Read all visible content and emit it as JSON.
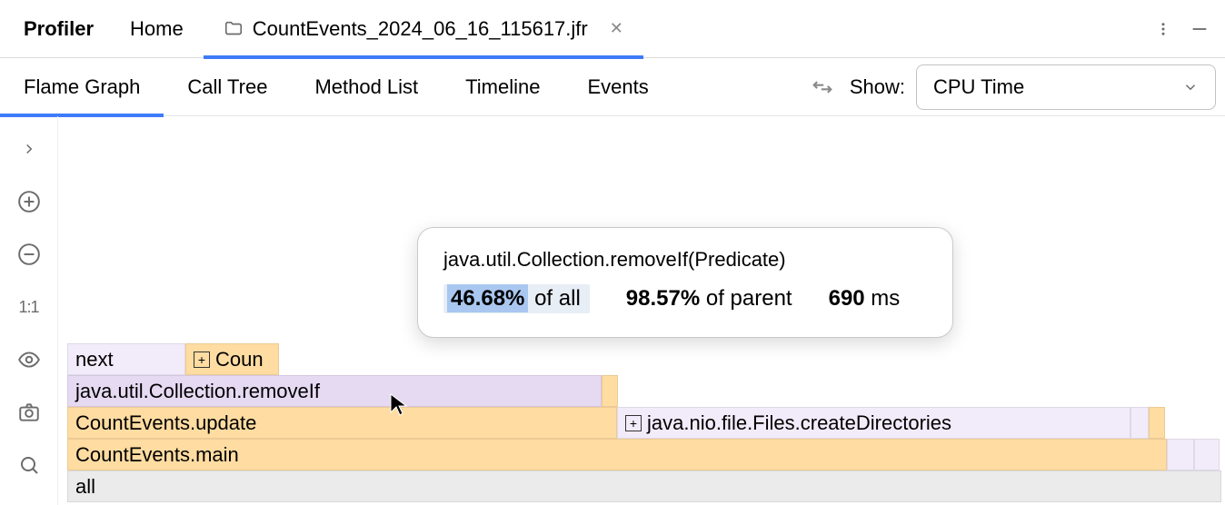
{
  "header": {
    "title": "Profiler",
    "tabs": [
      {
        "label": "Home",
        "active": false
      },
      {
        "label": "CountEvents_2024_06_16_115617.jfr",
        "active": true,
        "icon": "folder-icon",
        "closable": true
      }
    ]
  },
  "inner_tabs": [
    {
      "label": "Flame Graph",
      "active": true
    },
    {
      "label": "Call Tree",
      "active": false
    },
    {
      "label": "Method List",
      "active": false
    },
    {
      "label": "Timeline",
      "active": false
    },
    {
      "label": "Events",
      "active": false
    }
  ],
  "view_selector": {
    "label": "Show:",
    "value": "CPU Time"
  },
  "sidebar_tools": [
    {
      "name": "expand-icon"
    },
    {
      "name": "zoom-in-icon"
    },
    {
      "name": "zoom-out-icon"
    },
    {
      "name": "scale-1to1",
      "text": "1:1"
    },
    {
      "name": "eye-icon"
    },
    {
      "name": "camera-icon"
    },
    {
      "name": "search-icon"
    }
  ],
  "flame": {
    "rows": {
      "all": "all",
      "main": "CountEvents.main",
      "update": "CountEvents.update",
      "createDirs": "java.nio.file.Files.createDirectories",
      "removeIf": "java.util.Collection.removeIf",
      "next": "next",
      "coun": "Coun"
    }
  },
  "tooltip": {
    "title": "java.util.Collection.removeIf(Predicate)",
    "pct_all_value": "46.68%",
    "pct_all_suffix": " of all",
    "pct_parent_value": "98.57%",
    "pct_parent_suffix": " of parent",
    "time_value": "690",
    "time_unit": " ms"
  },
  "chart_data": {
    "type": "bar",
    "title": "Flame Graph (CPU Time)",
    "xlabel": "",
    "ylabel": "",
    "stack": [
      {
        "label": "all",
        "pct_of_all": 100.0,
        "children": [
          {
            "label": "CountEvents.main",
            "pct_of_all": 94.0,
            "children": [
              {
                "label": "CountEvents.update",
                "pct_of_all": 47.4,
                "children": [
                  {
                    "label": "java.util.Collection.removeIf",
                    "pct_of_all": 46.68,
                    "children": [
                      {
                        "label": "next",
                        "pct_of_all": 10.2
                      },
                      {
                        "label": "Coun",
                        "pct_of_all": 8.0,
                        "expandable": true
                      }
                    ]
                  }
                ]
              },
              {
                "label": "java.nio.file.Files.createDirectories",
                "pct_of_all": 44.6,
                "expandable": true
              }
            ]
          }
        ]
      }
    ],
    "hovered": {
      "method": "java.util.Collection.removeIf(Predicate)",
      "pct_of_all": 46.68,
      "pct_of_parent": 98.57,
      "time_ms": 690
    }
  }
}
